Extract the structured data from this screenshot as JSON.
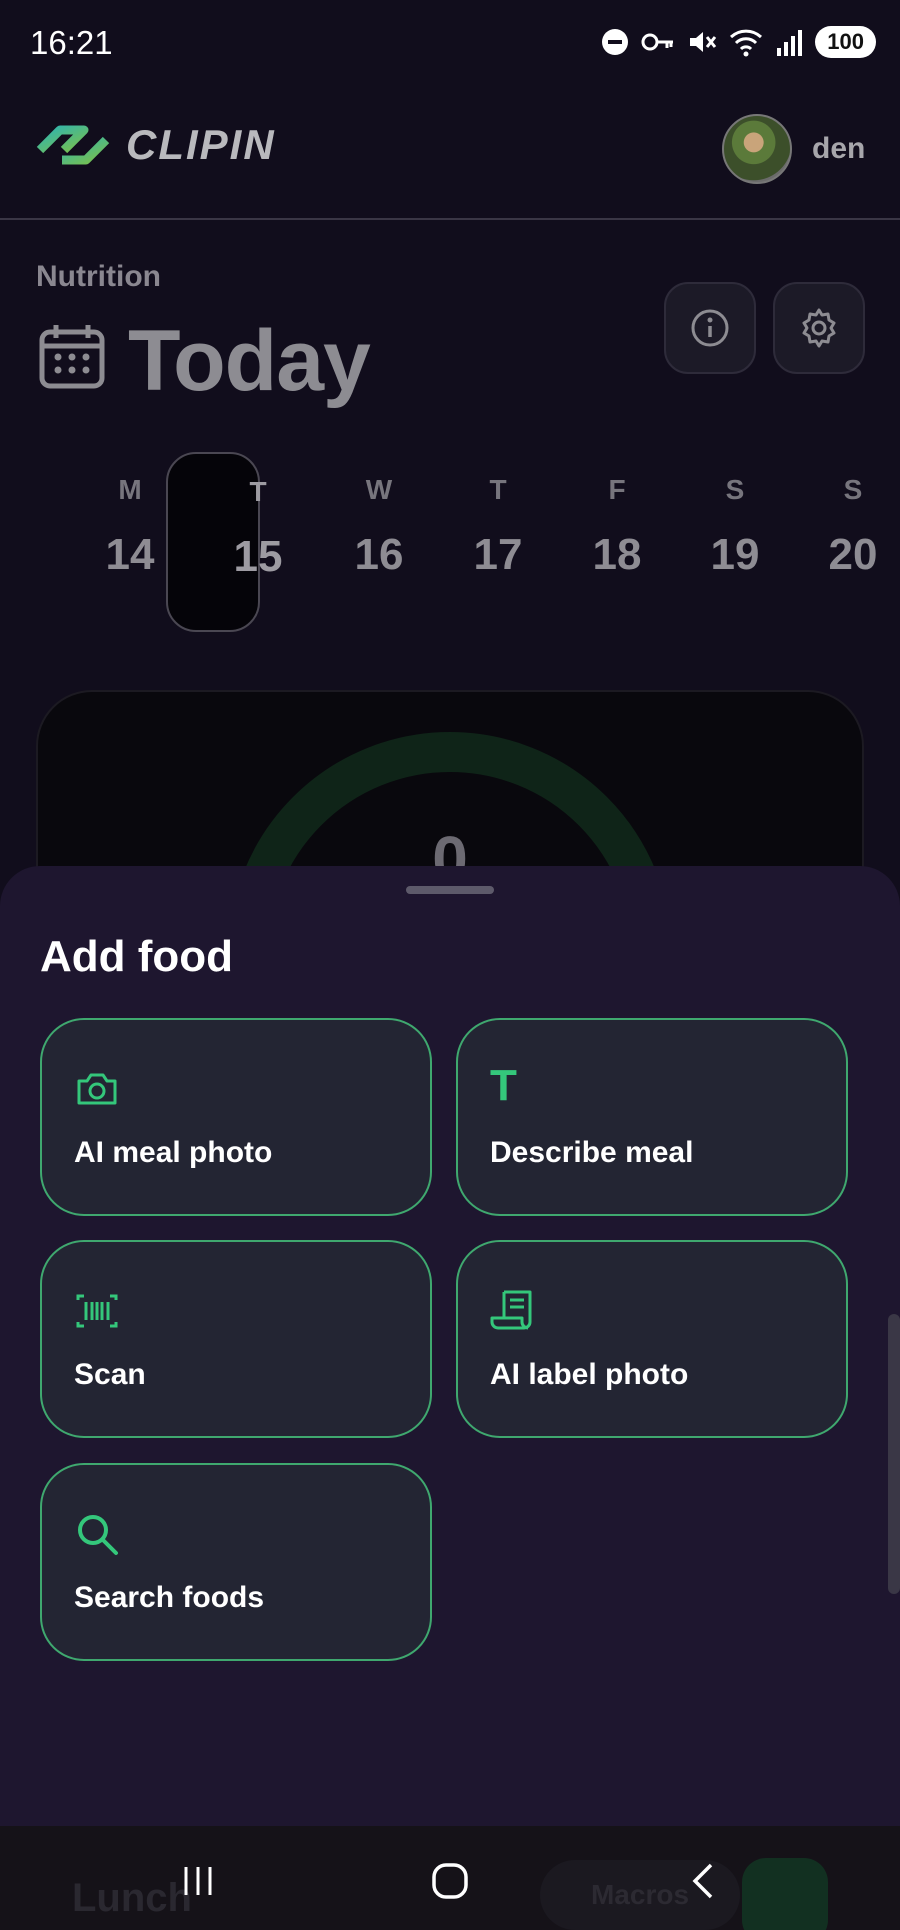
{
  "status_bar": {
    "time": "16:21",
    "battery": "100"
  },
  "header": {
    "app_name": "CLIPIN",
    "username": "den"
  },
  "page": {
    "section_label": "Nutrition",
    "title": "Today"
  },
  "week": [
    {
      "letter": "M",
      "num": "14"
    },
    {
      "letter": "T",
      "num": "15"
    },
    {
      "letter": "W",
      "num": "16"
    },
    {
      "letter": "T",
      "num": "17"
    },
    {
      "letter": "F",
      "num": "18"
    },
    {
      "letter": "S",
      "num": "19"
    },
    {
      "letter": "S",
      "num": "20"
    }
  ],
  "summary": {
    "value": "0"
  },
  "sheet": {
    "title": "Add food",
    "options": [
      {
        "label": "AI meal photo",
        "icon": "camera-icon"
      },
      {
        "label": "Describe meal",
        "icon": "text-icon"
      },
      {
        "label": "Scan",
        "icon": "barcode-icon"
      },
      {
        "label": "AI label photo",
        "icon": "receipt-icon"
      },
      {
        "label": "Search foods",
        "icon": "search-icon"
      }
    ]
  },
  "behind": {
    "lunch": "Lunch",
    "macros": "Macros"
  },
  "colors": {
    "accent": "#34c77b",
    "sheet_bg": "#1e162f",
    "tile_bg": "#232533"
  }
}
